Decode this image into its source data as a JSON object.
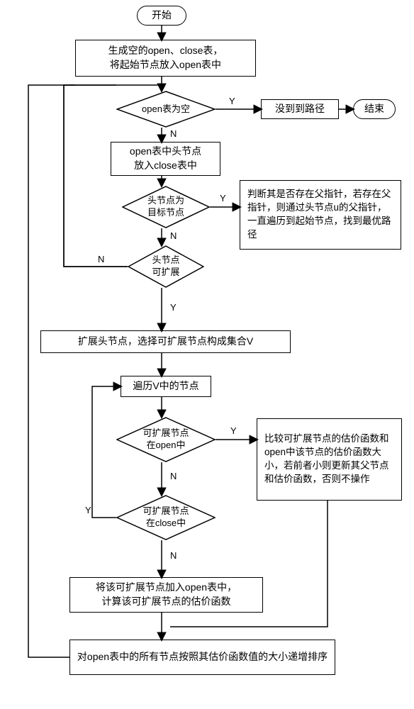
{
  "t_start": "开始",
  "t_end": "结束",
  "box_init": "生成空的open、close表，\n将起始节点放入open表中",
  "d_open_empty": "open表为空",
  "box_no_path": "没到到路径",
  "box_head_to_close": "open表中头节点\n放入close表中",
  "d_head_target": "头节点为\n目标节点",
  "box_parent_ptr": "判断其是否存在父指针，若存在父指针，则通过头节点u的父指针，一直遍历到起始节点，找到最优路径",
  "d_head_expand": "头节点\n可扩展",
  "box_expand_head": "扩展头节点，选择可扩展节点构成集合V",
  "box_traverse_v": "遍历V中的节点",
  "d_ext_in_open": "可扩展节点\n在open中",
  "box_compare": "比较可扩展节点的估价函数和open中该节点的估价函数大小，若前者小则更新其父节点和估价函数，否则不操作",
  "d_ext_in_close": "可扩展节点\n在close中",
  "box_add_open": "将该可扩展节点加入open表中，\n计算该可扩展节点的估价函数",
  "box_sort": "对open表中的所有节点按照其估价函数值的大小递增排序",
  "Y": "Y",
  "N": "N"
}
